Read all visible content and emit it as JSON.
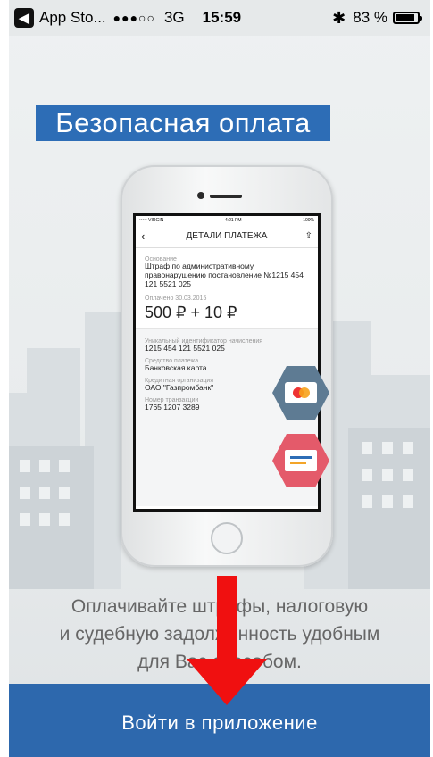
{
  "status_bar": {
    "back_app": "App Sto...",
    "signal_dots": "●●●○○",
    "network": "3G",
    "time": "15:59",
    "bluetooth_icon": "bluetooth-icon",
    "battery_percent": "83 %"
  },
  "title": "Безопасная оплата",
  "phone_screen": {
    "mini_status": {
      "carrier": "••••• VIRGIN",
      "time": "4:21 PM",
      "battery": "100%"
    },
    "header": "ДЕТАЛИ ПЛАТЕЖА",
    "basis_label": "Основание",
    "basis_value": "Штраф по административному правонарушению постановление №1215 454 121 5521 025",
    "paid_label": "Оплачено 30.03.2015",
    "amount": "500 ₽  + 10 ₽",
    "uid_label": "Уникальный идентификатор начисления",
    "uid_value": "1215 454 121 5521 025",
    "method_label": "Средство платежа",
    "method_value": "Банковская карта",
    "org_label": "Кредитная организация",
    "org_value": "ОАО \"Газпромбанк\"",
    "txn_label": "Номер транзакции",
    "txn_value": "1765 1207 3289"
  },
  "description": {
    "line1": "Оплачивайте штрафы, налоговую",
    "line2": "и судебную задолженность удобным",
    "line3": "для Вас способом."
  },
  "login_button": "Войти в приложение",
  "colors": {
    "brand_blue": "#2d6db6",
    "arrow_red": "#f01010",
    "hex_card": "#5e7b93",
    "hex_doc": "#e45a6a"
  }
}
